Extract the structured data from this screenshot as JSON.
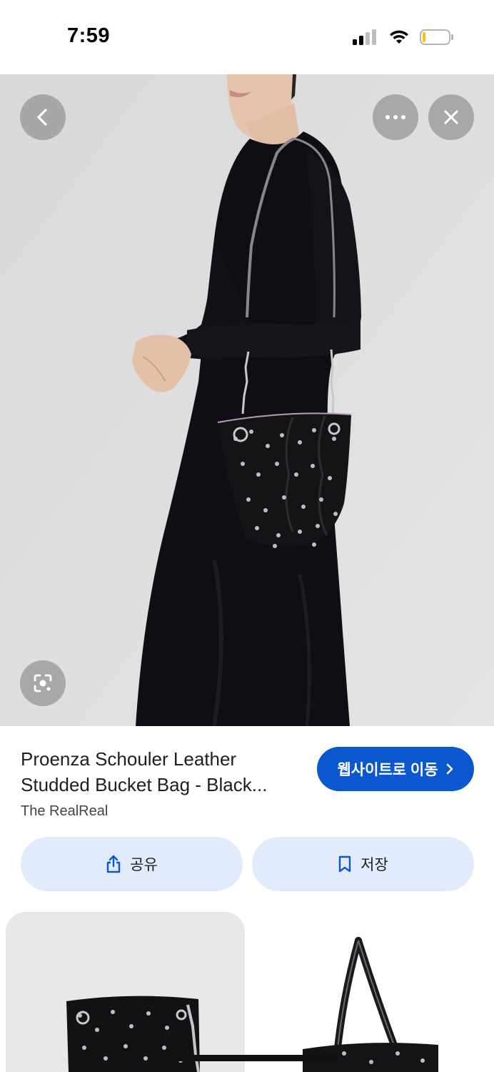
{
  "status_bar": {
    "time": "7:59"
  },
  "product": {
    "title": "Proenza Schouler Leather Studded Bucket Bag - Black...",
    "source": "The RealReal"
  },
  "actions": {
    "visit_label": "웹사이트로 이동",
    "share_label": "공유",
    "save_label": "저장"
  },
  "icons": {
    "back": "chevron-left-icon",
    "more": "more-horizontal-icon",
    "close": "close-icon",
    "lens": "lens-icon",
    "share": "share-icon",
    "save": "bookmark-icon"
  },
  "colors": {
    "accent": "#0b57d0",
    "chip_bg": "#e2ebfb",
    "hero_bg": "#dcdcdc"
  }
}
